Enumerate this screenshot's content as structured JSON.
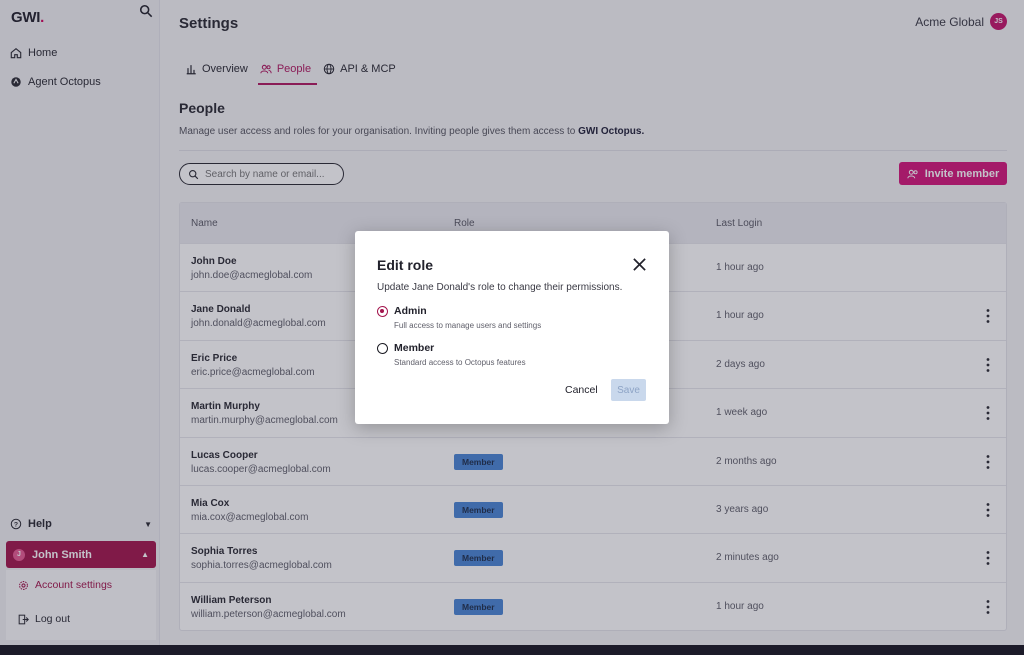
{
  "sidebar": {
    "logo": "GWI",
    "items": [
      {
        "label": "Home",
        "icon": "home-icon"
      },
      {
        "label": "Agent Octopus",
        "icon": "octopus-icon"
      }
    ],
    "help_label": "Help",
    "user": {
      "initial": "J",
      "name": "John Smith"
    },
    "user_menu": [
      {
        "label": "Account settings",
        "icon": "gear-icon"
      },
      {
        "label": "Log out",
        "icon": "logout-icon"
      }
    ]
  },
  "header": {
    "title": "Settings",
    "org_name": "Acme Global",
    "org_initials": "JS"
  },
  "tabs": [
    {
      "label": "Overview",
      "icon": "chart-icon",
      "active": false
    },
    {
      "label": "People",
      "icon": "people-icon",
      "active": true
    },
    {
      "label": "API & MCP",
      "icon": "globe-icon",
      "active": false
    }
  ],
  "people": {
    "title": "People",
    "description_text": "Manage user access and roles for your organisation. Inviting people gives them access to ",
    "description_bold": "GWI Octopus.",
    "search_placeholder": "Search by name or email...",
    "invite_label": "Invite member",
    "columns": {
      "name": "Name",
      "role": "Role",
      "last_login": "Last Login"
    },
    "rows": [
      {
        "name": "John Doe",
        "email": "john.doe@acmeglobal.com",
        "role": "",
        "last_login": "1 hour ago",
        "menu": false
      },
      {
        "name": "Jane Donald",
        "email": "john.donald@acmeglobal.com",
        "role": "",
        "last_login": "1 hour ago",
        "menu": true
      },
      {
        "name": "Eric Price",
        "email": "eric.price@acmeglobal.com",
        "role": "",
        "last_login": "2 days ago",
        "menu": true
      },
      {
        "name": "Martin Murphy",
        "email": "martin.murphy@acmeglobal.com",
        "role": "",
        "last_login": "1 week ago",
        "menu": true
      },
      {
        "name": "Lucas Cooper",
        "email": "lucas.cooper@acmeglobal.com",
        "role": "Member",
        "last_login": "2 months ago",
        "menu": true
      },
      {
        "name": "Mia Cox",
        "email": "mia.cox@acmeglobal.com",
        "role": "Member",
        "last_login": "3 years ago",
        "menu": true
      },
      {
        "name": "Sophia Torres",
        "email": "sophia.torres@acmeglobal.com",
        "role": "Member",
        "last_login": "2 minutes ago",
        "menu": true
      },
      {
        "name": "William Peterson",
        "email": "william.peterson@acmeglobal.com",
        "role": "Member",
        "last_login": "1 hour ago",
        "menu": true
      }
    ]
  },
  "modal": {
    "title": "Edit role",
    "description": "Update Jane Donald's role to change their permissions.",
    "options": [
      {
        "label": "Admin",
        "sub": "Full access to manage users and settings",
        "checked": true
      },
      {
        "label": "Member",
        "sub": "Standard access to Octopus features",
        "checked": false
      }
    ],
    "cancel_label": "Cancel",
    "save_label": "Save"
  },
  "colors": {
    "brand": "#d4157a",
    "user_row": "#a3154d",
    "role_badge": "#4a86d4"
  }
}
